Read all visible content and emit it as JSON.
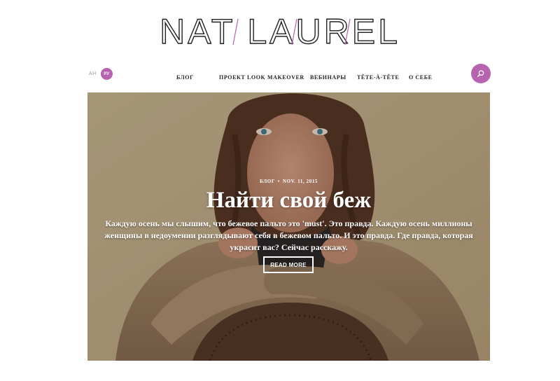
{
  "brand": {
    "logo_text": "NAT LAUREL",
    "accent_color": "#b663b0"
  },
  "language": {
    "en": "AH",
    "ru": "РУ"
  },
  "nav": {
    "items": [
      "БЛОГ",
      "ПРОЕКТ LOOK MAKEOVER",
      "ВЕБИНАРЫ",
      "TÊTE-À-TÊTE",
      "О СЕБЕ"
    ]
  },
  "search": {
    "icon": "search-icon"
  },
  "hero": {
    "category": "БЛОГ",
    "date": "NOV. 11, 2015",
    "title": "Найти свой беж",
    "excerpt": "Каждую осень мы слышим, что бежевое пальто это 'must'. Это правда. Каждую осень миллионы женщины в недоумении разглядывают себя в бежевом пальто. И это правда. Где правда, которая украсит вас? Сейчас расскажу.",
    "read_more": "READ MORE"
  }
}
